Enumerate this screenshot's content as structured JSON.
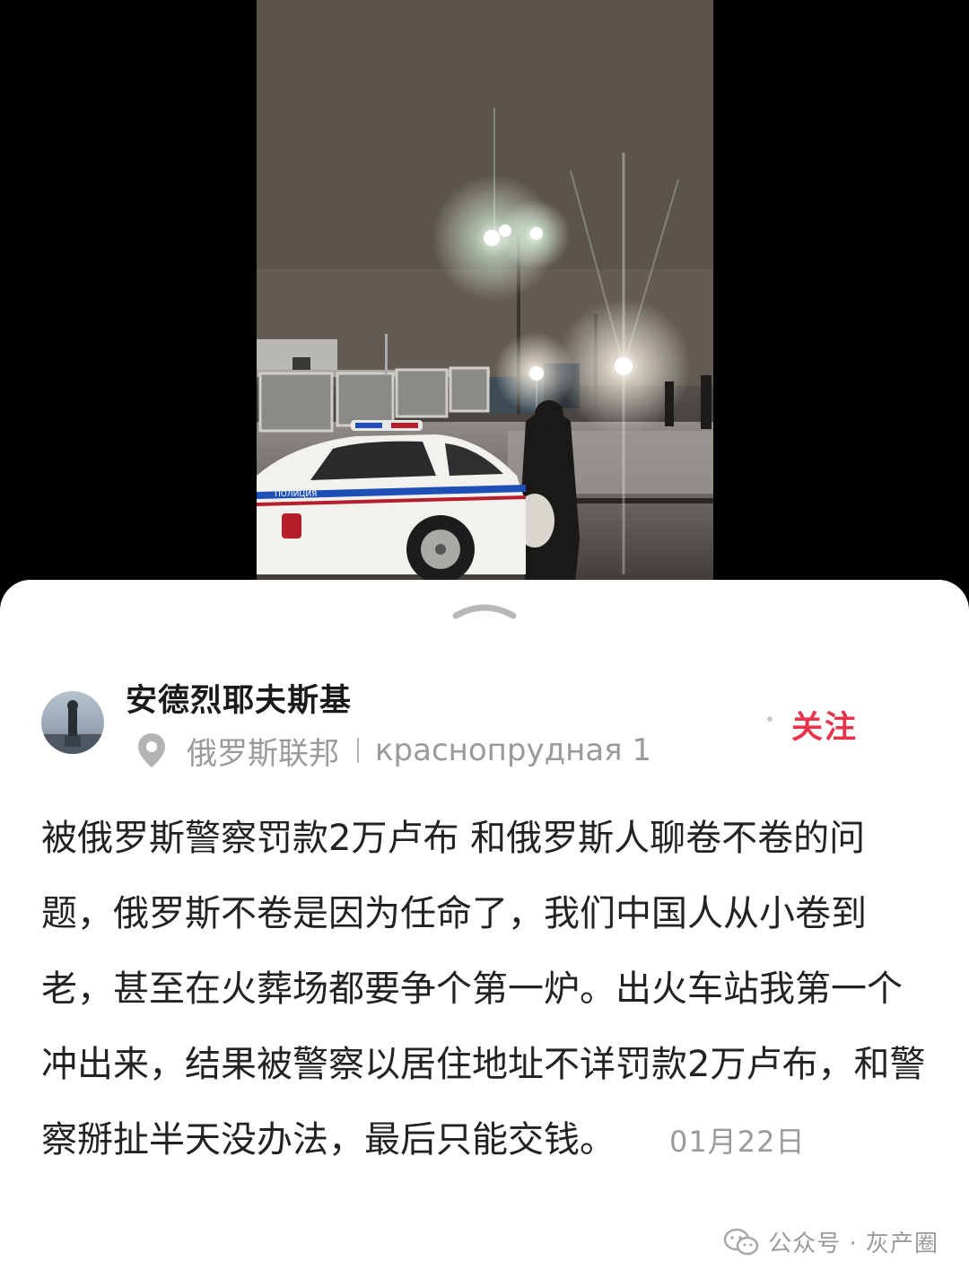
{
  "post": {
    "author": "安德烈耶夫斯基",
    "location_region": "俄罗斯联邦",
    "location_place": "краснопрудная 1",
    "follow_label": "关注",
    "content": "被俄罗斯警察罚款2万卢布 和俄罗斯人聊卷不卷的问题，俄罗斯不卷是因为任命了，我们中国人从小卷到老，甚至在火葬场都要争个第一炉。出火车站我第一个冲出来，结果被警察以居住地址不详罚款2万卢布，和警察掰扯半天没办法，最后只能交钱。",
    "date": "01月22日"
  },
  "photo": {
    "car_marking": "ПОЛИЦИЯ"
  },
  "watermark": {
    "text": "公众号 · 灰产圈"
  },
  "colors": {
    "follow": "#e8334a",
    "muted_text": "#9a9a9a"
  }
}
